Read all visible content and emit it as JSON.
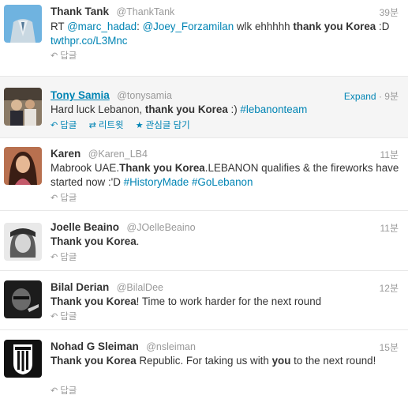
{
  "colors": {
    "link": "#0084b4",
    "muted": "#999999",
    "text": "#333333",
    "divider": "#e8e8e8",
    "hover_bg": "#f5f5f5"
  },
  "icons": {
    "reply": "reply-arrow-icon",
    "retweet": "retweet-icon",
    "favorite": "star-icon"
  },
  "tweets": [
    {
      "name": "Thank Tank",
      "handle": "@ThankTank",
      "time": "39분",
      "text_parts": [
        "RT ",
        "@marc_hadad",
        ": ",
        "@Joey_Forzamilan",
        " wlk ehhhhh ",
        "thank you Korea",
        " :D ",
        "twthpr.co/L3Mnc"
      ],
      "actions": {
        "reply": "답글"
      }
    },
    {
      "name": "Tony Samia",
      "handle": "@tonysamia",
      "time": "9분",
      "expand": "Expand",
      "text_parts": [
        "Hard luck Lebanon, ",
        "thank you Korea",
        " :) ",
        "#lebanonteam"
      ],
      "actions": {
        "reply": "답글",
        "retweet": "리트윗",
        "favorite": "관심글 담기"
      }
    },
    {
      "name": "Karen",
      "handle": "@Karen_LB4",
      "time": "11분",
      "text_parts": [
        "Mabrook UAE.",
        "Thank you Korea",
        ".LEBANON qualifies & the fireworks have started now :'D ",
        "#HistoryMade",
        " ",
        "#GoLebanon"
      ],
      "actions": {
        "reply": "답글"
      }
    },
    {
      "name": "Joelle Beaino",
      "handle": "@JOelleBeaino",
      "time": "11분",
      "text_parts": [
        "Thank you Korea",
        "."
      ],
      "actions": {
        "reply": "답글"
      }
    },
    {
      "name": "Bilal Derian",
      "handle": "@BilalDee",
      "time": "12분",
      "text_parts": [
        "Thank you Korea",
        "! Time to work harder for the next round"
      ],
      "actions": {
        "reply": "답글"
      }
    },
    {
      "name": "Nohad G Sleiman",
      "handle": "@nsleiman",
      "time": "15분",
      "text_parts": [
        "Thank you Korea",
        " Republic. For taking us with ",
        "you",
        " to the next round!"
      ],
      "actions": {
        "reply": "답글"
      }
    }
  ]
}
